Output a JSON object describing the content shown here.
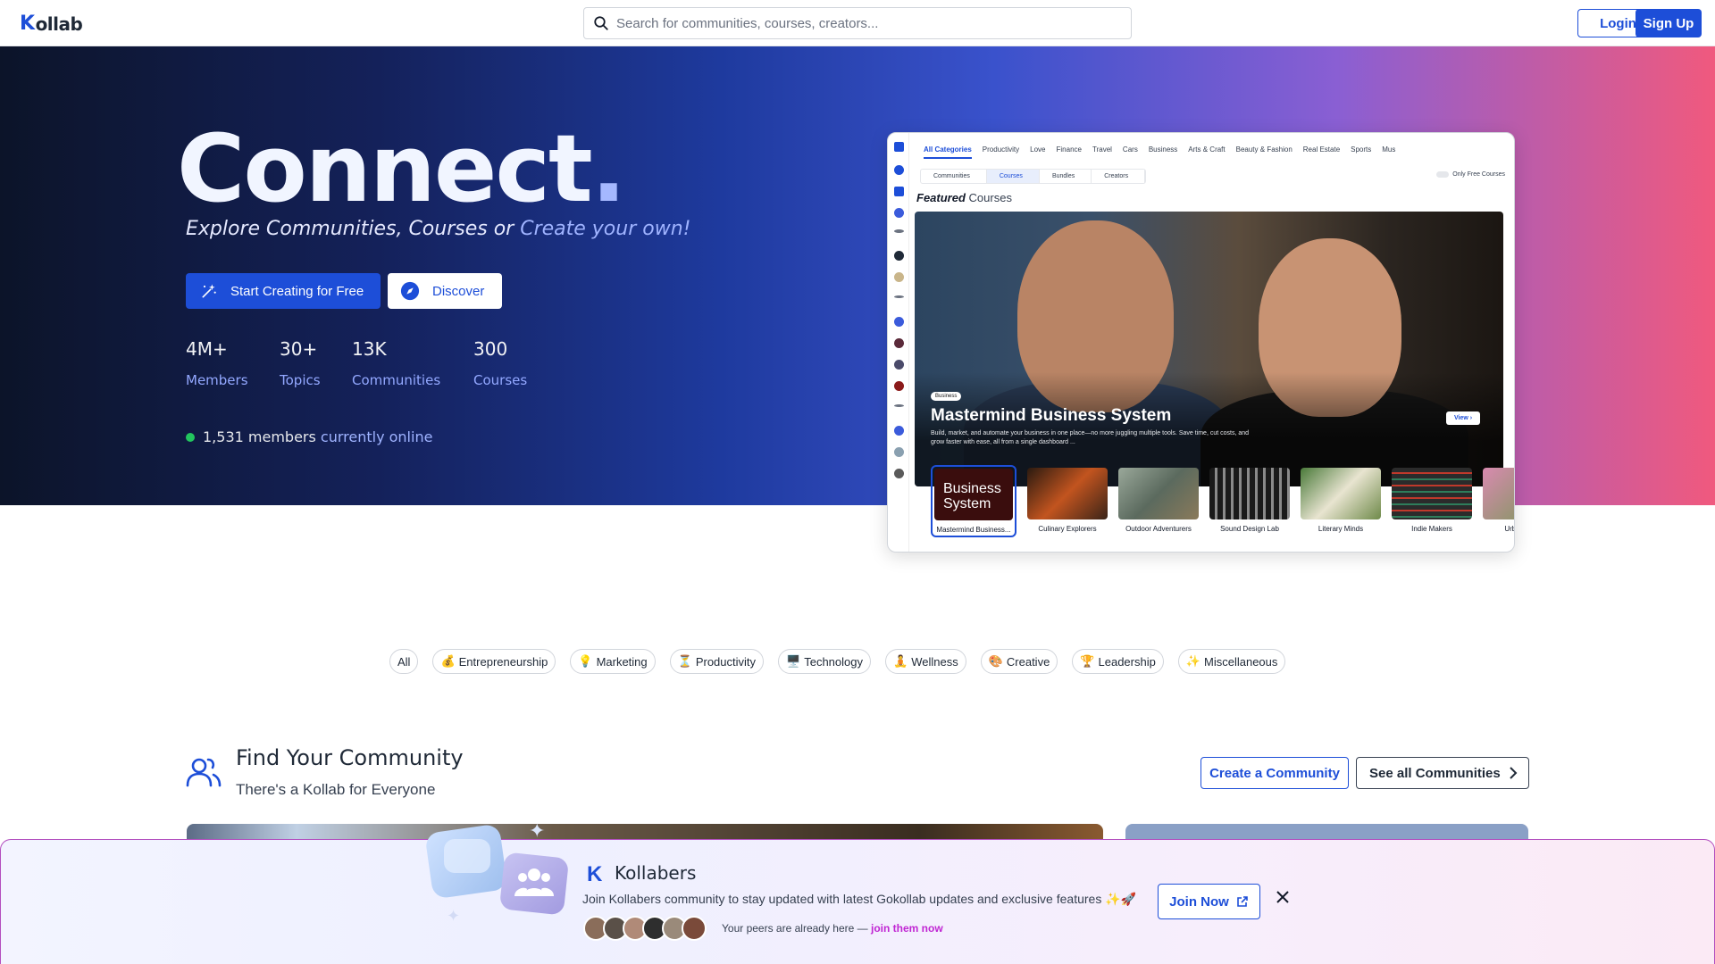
{
  "header": {
    "logo": "ollab",
    "search_placeholder": "Search for communities, courses, creators...",
    "login_label": "Login",
    "signup_label": "Sign Up"
  },
  "hero": {
    "title": "Connect",
    "title_dot": ".",
    "subtitle_part1": "Explore Communities, ",
    "subtitle_part2": "Courses or ",
    "subtitle_part3": "Create your own!",
    "start_label": "Start Creating for Free",
    "discover_label": "Discover",
    "stats": [
      {
        "num": "4M+",
        "label": "Members"
      },
      {
        "num": "30+",
        "label": "Topics"
      },
      {
        "num": "13K",
        "label": "Communities"
      },
      {
        "num": "300",
        "label": "Courses"
      }
    ],
    "online_count": "1,531 members ",
    "online_text": "currently online"
  },
  "preview": {
    "categories": [
      "All Categories",
      "Productivity",
      "Love",
      "Finance",
      "Travel",
      "Cars",
      "Business",
      "Arts & Craft",
      "Beauty & Fashion",
      "Real Estate",
      "Sports",
      "Mus"
    ],
    "tabs": [
      "Communities",
      "Courses",
      "Bundles",
      "Creators"
    ],
    "only_free": "Only Free Courses",
    "featured": "Featured",
    "featured_rest": "Courses",
    "badge": "Business",
    "course_title": "Mastermind Business System",
    "course_desc": "Build, market, and automate your business in one place—no more juggling multiple tools. Save time, cut costs, and grow faster with ease, all from a single dashboard ...",
    "view_label": "View",
    "thumb_selected_text": "Business System",
    "thumbs": [
      {
        "caption": "Mastermind Business...",
        "color": "#3a0d0d"
      },
      {
        "caption": "Culinary Explorers",
        "color": "#3a2418"
      },
      {
        "caption": "Outdoor Adventurers",
        "color": "#5b6a5e"
      },
      {
        "caption": "Sound Design Lab",
        "color": "#3a3a3a"
      },
      {
        "caption": "Literary Minds",
        "color": "#6f8a4a"
      },
      {
        "caption": "Indie Makers",
        "color": "#2b2b2b"
      },
      {
        "caption": "Urban Ga...",
        "color": "#c77aa3"
      }
    ]
  },
  "chips": [
    {
      "emoji": "",
      "label": "All"
    },
    {
      "emoji": "💰",
      "label": "Entrepreneurship"
    },
    {
      "emoji": "💡",
      "label": "Marketing"
    },
    {
      "emoji": "⏳",
      "label": "Productivity"
    },
    {
      "emoji": "🖥️",
      "label": "Technology"
    },
    {
      "emoji": "🧘",
      "label": "Wellness"
    },
    {
      "emoji": "🎨",
      "label": "Creative"
    },
    {
      "emoji": "🏆",
      "label": "Leadership"
    },
    {
      "emoji": "✨",
      "label": "Miscellaneous"
    }
  ],
  "find": {
    "title": "Find Your Community",
    "subtitle": "There's a Kollab for Everyone",
    "create_label": "Create a Community",
    "see_all_label": "See all Communities"
  },
  "banner": {
    "title": "Kollabers",
    "desc": "Join Kollabers community to stay updated with latest Gokollab updates and exclusive features ✨🚀",
    "peers_text": "Your peers are already here — ",
    "peers_link": "join them now",
    "join_label": "Join Now",
    "avatar_colors": [
      "#8a6d5a",
      "#5a5048",
      "#b08a78",
      "#2e2e2e",
      "#9a8a7a",
      "#7a4a3a"
    ]
  },
  "colors": {
    "accent": "#1d4ed8",
    "online": "#22c55e",
    "banner_border": "#b34fbf"
  }
}
